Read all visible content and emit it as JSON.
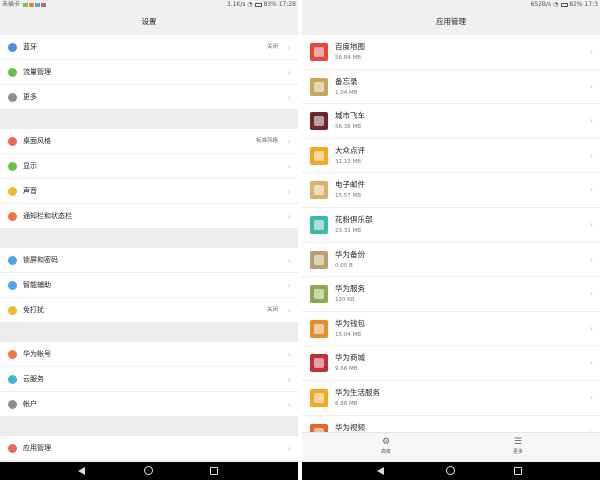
{
  "left": {
    "status": {
      "carrier": "未插卡",
      "speed": "3.1K/s",
      "battery": "83%",
      "time": "17:28"
    },
    "title": "设置",
    "groups": [
      {
        "items": [
          {
            "label": "蓝牙",
            "value": "关闭",
            "color": "#4a90e2"
          },
          {
            "label": "流量管理",
            "value": "",
            "color": "#6cc04a"
          },
          {
            "label": "更多",
            "value": "",
            "color": "#8e8e8e"
          }
        ]
      },
      {
        "items": [
          {
            "label": "桌面风格",
            "value": "标准风格",
            "color": "#f0645a"
          },
          {
            "label": "显示",
            "value": "",
            "color": "#6cc04a"
          },
          {
            "label": "声音",
            "value": "",
            "color": "#f5b92e"
          },
          {
            "label": "通知栏和状态栏",
            "value": "",
            "color": "#f07840"
          }
        ]
      },
      {
        "items": [
          {
            "label": "锁屏和密码",
            "value": "",
            "color": "#4aa5e8"
          },
          {
            "label": "智能辅助",
            "value": "",
            "color": "#4aa5e8"
          },
          {
            "label": "免打扰",
            "value": "关闭",
            "color": "#f5b92e"
          }
        ]
      },
      {
        "items": [
          {
            "label": "华为帐号",
            "value": "",
            "color": "#f07840"
          },
          {
            "label": "云服务",
            "value": "",
            "color": "#3fb8d4"
          },
          {
            "label": "帐户",
            "value": "",
            "color": "#8e8e8e"
          }
        ]
      },
      {
        "items": [
          {
            "label": "应用管理",
            "value": "",
            "color": "#f0645a"
          }
        ]
      }
    ]
  },
  "right": {
    "status": {
      "speed": "652B/s",
      "battery": "82%",
      "time": "17:3"
    },
    "title": "应用管理",
    "apps": [
      {
        "name": "百度地图",
        "size": "56.84 MB",
        "color": "#e8453c"
      },
      {
        "name": "备忘录",
        "size": "1.04 MB",
        "color": "#c8a75e"
      },
      {
        "name": "城市飞车",
        "size": "56.38 MB",
        "color": "#6b2a2a"
      },
      {
        "name": "大众点评",
        "size": "32.12 MB",
        "color": "#f5a623"
      },
      {
        "name": "电子邮件",
        "size": "15.57 MB",
        "color": "#d9b26b"
      },
      {
        "name": "花粉俱乐部",
        "size": "23.31 MB",
        "color": "#3fb8a8"
      },
      {
        "name": "华为备份",
        "size": "0.00 B",
        "color": "#b8a070"
      },
      {
        "name": "华为服务",
        "size": "120 KB",
        "color": "#8fa84a"
      },
      {
        "name": "华为钱包",
        "size": "15.04 MB",
        "color": "#e0902e"
      },
      {
        "name": "华为商城",
        "size": "9.66 MB",
        "color": "#c0303a"
      },
      {
        "name": "华为生活服务",
        "size": "8.88 MB",
        "color": "#f5a623"
      },
      {
        "name": "华为视频",
        "size": "",
        "color": "#e06a2a"
      }
    ],
    "tabs": [
      {
        "label": "高级",
        "icon": "gear-icon"
      },
      {
        "label": "更多",
        "icon": "menu-icon"
      }
    ]
  },
  "nav_icons": [
    "back-icon",
    "home-icon",
    "recent-apps-icon"
  ],
  "colors": {
    "accent": "#4a90e2",
    "separator": "#ececec",
    "navbar": "#000000"
  }
}
